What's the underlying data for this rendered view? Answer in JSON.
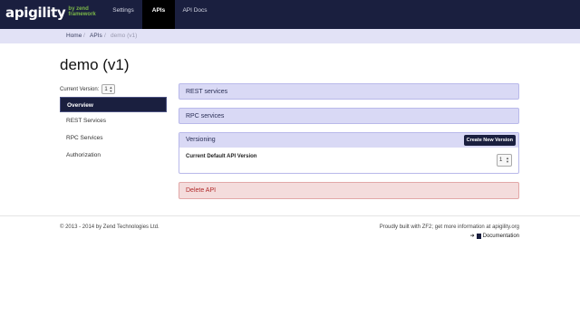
{
  "brand": {
    "main": "apigility",
    "by": "by zend",
    "framework": "framework"
  },
  "nav": {
    "settings": "Settings",
    "apis": "APIs",
    "api_docs": "API Docs"
  },
  "breadcrumb": {
    "home": "Home",
    "sep": "/",
    "apis": "APIs",
    "current": "demo (v1)"
  },
  "page": {
    "title": "demo (v1)"
  },
  "sidebar": {
    "version_label": "Current Version:",
    "version_value": "1",
    "items": [
      {
        "label": "Overview",
        "active": true
      },
      {
        "label": "REST Services",
        "active": false
      },
      {
        "label": "RPC Services",
        "active": false
      },
      {
        "label": "Authorization",
        "active": false
      }
    ]
  },
  "panels": {
    "rest": "REST services",
    "rpc": "RPC services",
    "versioning": {
      "title": "Versioning",
      "create_button": "Create New Version",
      "default_label": "Current Default API Version",
      "default_value": "1"
    },
    "delete": "Delete API"
  },
  "footer": {
    "copyright": "© 2013 - 2014 by Zend Technologies Ltd.",
    "built": "Proudly built with ZF2; get more information at apigility.org",
    "doc_arrow": "➜",
    "documentation": "Documentation"
  },
  "colors": {
    "navbar": "#1a1f3f",
    "accent_panel": "#d9d9f5",
    "danger_panel": "#f4dcdc",
    "brand_green": "#7ab648"
  }
}
